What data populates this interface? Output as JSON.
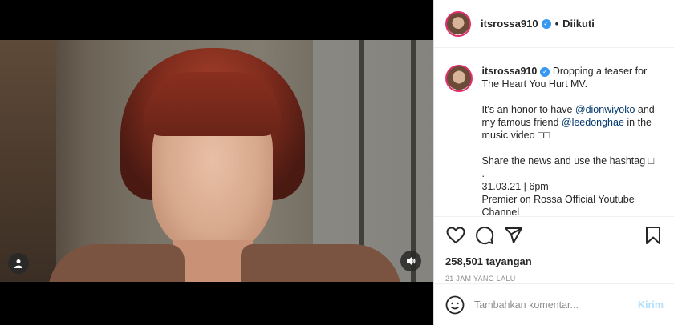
{
  "post": {
    "username": "itsrossa910",
    "follow_status": "Diikuti",
    "caption": {
      "line1": "Dropping a teaser for The Heart You Hurt MV.",
      "p2_pre": "It's an honor to have ",
      "mention1": "@dionwiyoko",
      "p2_mid": " and my famous friend ",
      "mention2": "@leedonghae",
      "p2_post": " in the music video ",
      "p2_emoji": "□□",
      "p3": "Share the news and use the hashtag □",
      "p3_dot": ".",
      "p4_l1": "31.03.21 | 6pm",
      "p4_l2": "Premier on Rossa Official Youtube",
      "p4_l3": "Channel"
    },
    "views": "258,501 tayangan",
    "timestamp": "21 JAM YANG LALU",
    "comment_placeholder": "Tambahkan komentar...",
    "send_label": "Kirim"
  },
  "icons": {
    "like": "heart-icon",
    "comment": "comment-icon",
    "share": "share-icon",
    "save": "bookmark-icon",
    "user": "user-icon",
    "sound": "speaker-icon",
    "emoji": "emoji-icon",
    "verified": "verified-badge-icon"
  },
  "colors": {
    "verified": "#3897f0",
    "mention": "#00376b",
    "send_disabled": "#b2dffc",
    "story_ring": "#e1306c"
  }
}
